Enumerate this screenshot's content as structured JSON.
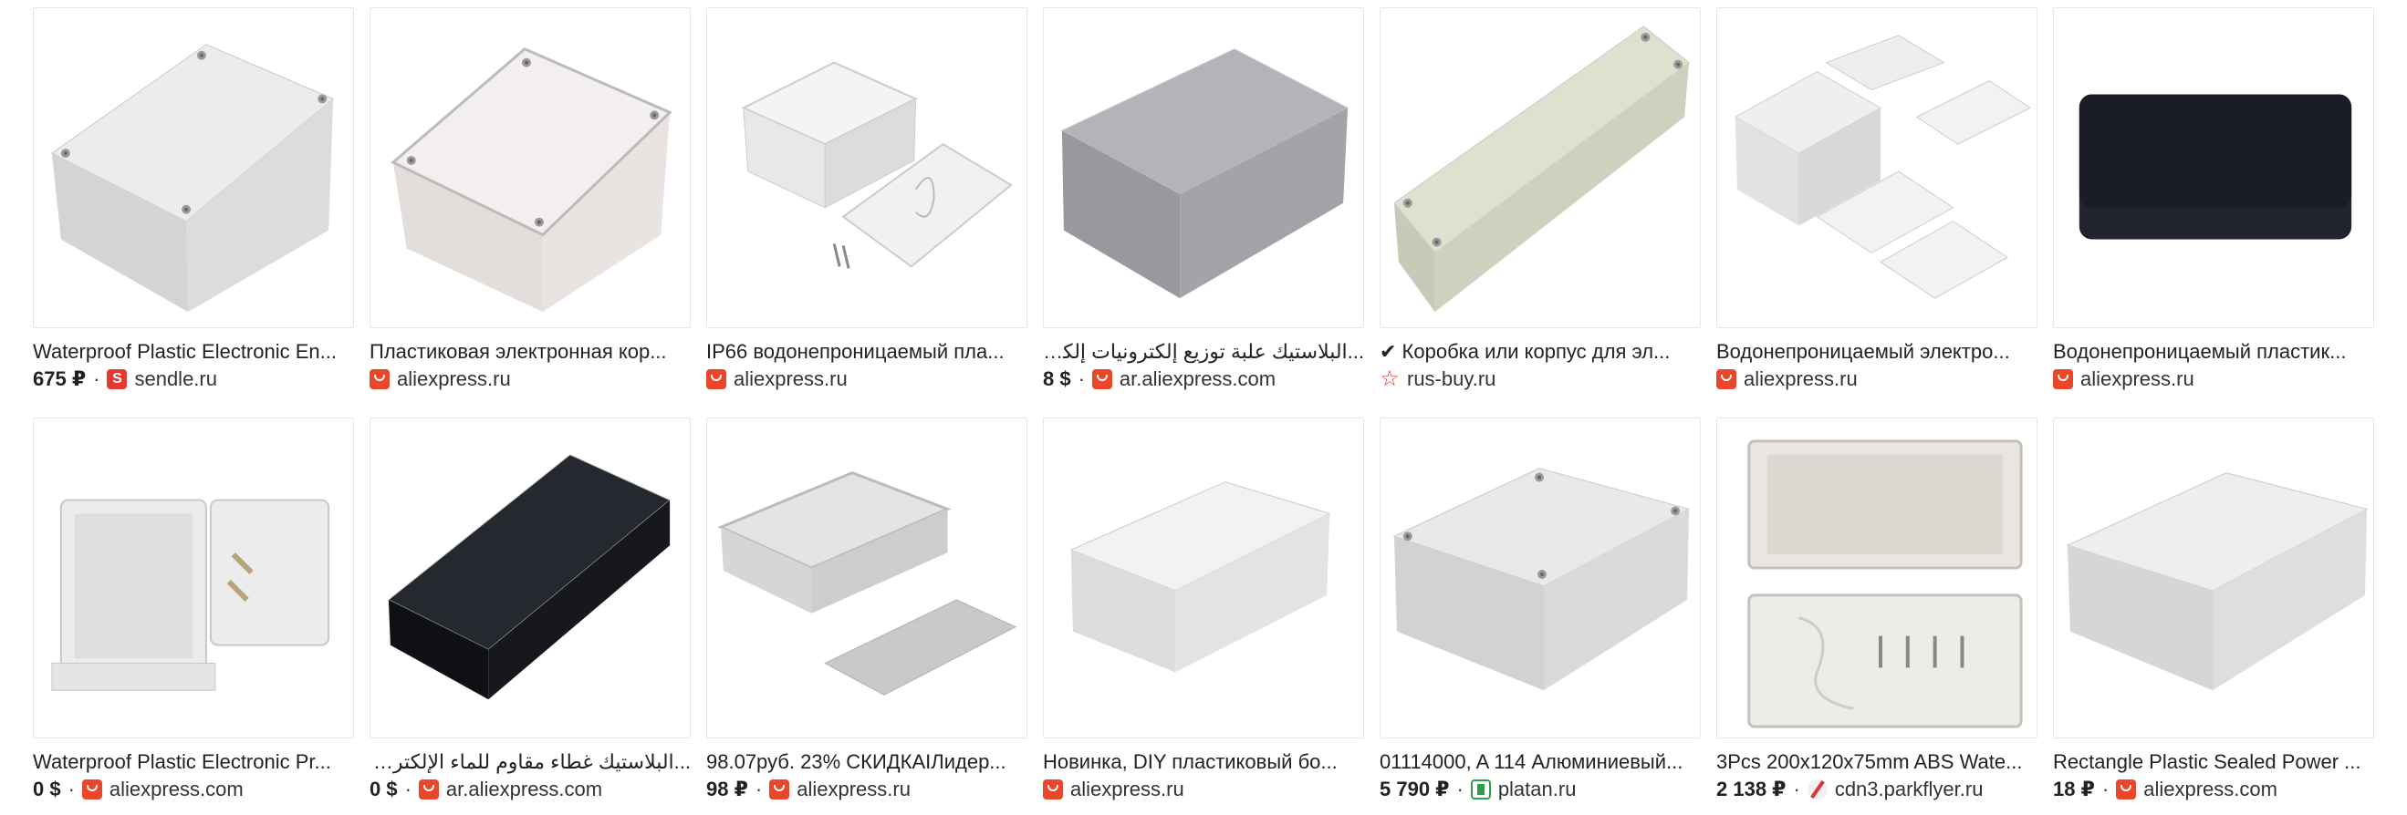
{
  "results": [
    {
      "title": "Waterproof Plastic Electronic En...",
      "price": "675 ₽",
      "favicon": "sendle-icon",
      "domain": "sendle.ru",
      "thumb": "grey-enclosure-closed"
    },
    {
      "title": "Пластиковая электронная кор...",
      "price": "",
      "favicon": "aliexpress-icon",
      "domain": "aliexpress.ru",
      "thumb": "clear-lid-enclosure"
    },
    {
      "title": "IP66 водонепроницаемый пла...",
      "price": "",
      "favicon": "aliexpress-icon",
      "domain": "aliexpress.ru",
      "thumb": "open-box-with-lid"
    },
    {
      "title": "...البلاستيك علبة توزيع إلكترونيات إلكترونية ال",
      "price": "8 $",
      "favicon": "aliexpress-icon",
      "domain": "ar.aliexpress.com",
      "thumb": "grey-desktop-case",
      "rtl": true
    },
    {
      "title": "✔ Коробка или корпус для эл...",
      "price": "",
      "favicon": "star-icon",
      "domain": "rus-buy.ru",
      "thumb": "long-beige-enclosure"
    },
    {
      "title": "Водонепроницаемый электро...",
      "price": "",
      "favicon": "aliexpress-icon",
      "domain": "aliexpress.ru",
      "thumb": "vented-enclosure-parts"
    },
    {
      "title": "Водонепроницаемый пластик...",
      "price": "",
      "favicon": "aliexpress-icon",
      "domain": "aliexpress.ru",
      "thumb": "black-enclosure"
    },
    {
      "title": "Waterproof Plastic Electronic Pr...",
      "price": "0 $",
      "favicon": "aliexpress-icon",
      "domain": "aliexpress.com",
      "thumb": "flanged-open-box"
    },
    {
      "title": "...البلاستيك غطاء مقاوم للماء الإلكترونية مشرو",
      "price": "0 $",
      "favicon": "aliexpress-icon",
      "domain": "ar.aliexpress.com",
      "thumb": "black-enclosure-large",
      "rtl": true
    },
    {
      "title": "98.07руб. 23% СКИДКАІЛидер...",
      "price": "98 ₽",
      "favicon": "aliexpress-icon",
      "domain": "aliexpress.ru",
      "thumb": "open-tray-with-lid"
    },
    {
      "title": "Новинка, DIY пластиковый бо...",
      "price": "",
      "favicon": "aliexpress-icon",
      "domain": "aliexpress.ru",
      "thumb": "white-rounded-box"
    },
    {
      "title": "01114000, A 114 Алюминиевый...",
      "price": "5 790 ₽",
      "favicon": "platan-icon",
      "domain": "platan.ru",
      "thumb": "grey-enclosure-wide"
    },
    {
      "title": "3Pcs 200x120x75mm ABS Wate...",
      "price": "2 138 ₽",
      "favicon": "parkflyer-icon",
      "domain": "cdn3.parkflyer.ru",
      "thumb": "flanged-box-kit"
    },
    {
      "title": "Rectangle Plastic Sealed Power ...",
      "price": "18 ₽",
      "favicon": "aliexpress-icon",
      "domain": "aliexpress.com",
      "thumb": "grey-sealed-box"
    }
  ]
}
